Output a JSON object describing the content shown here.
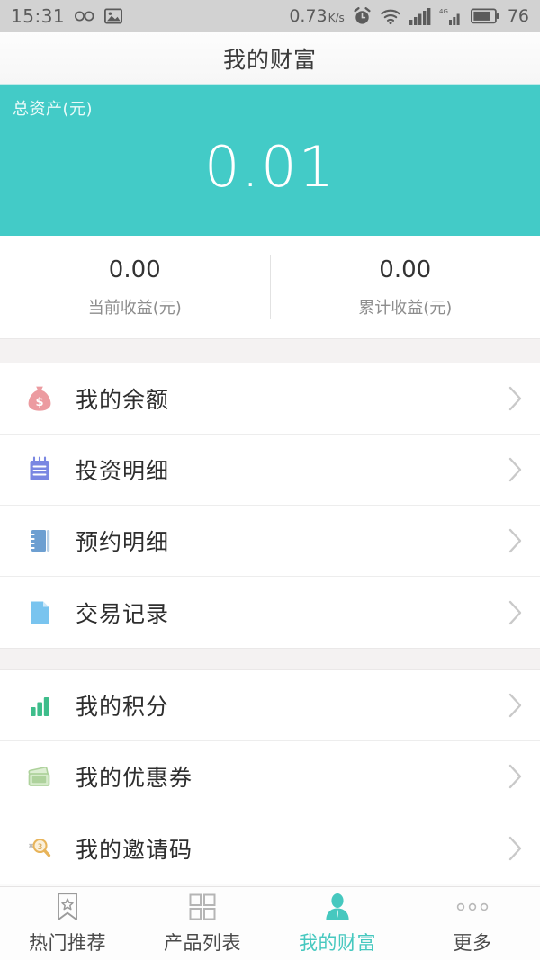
{
  "statusbar": {
    "time": "15:31",
    "infinity_icon": "infinity-icon",
    "gallery_icon": "image-icon",
    "network_speed": "0.73",
    "network_speed_unit": "K/s",
    "alarm_icon": "alarm-clock-icon",
    "wifi_icon": "wifi-icon",
    "signal_icon": "signal-bars-icon",
    "signal_4g_icon": "4g-signal-icon",
    "signal_4g_label": "4G",
    "battery_icon": "battery-icon",
    "battery_level": "76"
  },
  "titlebar": {
    "title": "我的财富"
  },
  "hero": {
    "label": "总资产(元)",
    "amount": "0.01",
    "background_color": "#43cbc7"
  },
  "stats": [
    {
      "value": "0.00",
      "caption": "当前收益(元)"
    },
    {
      "value": "0.00",
      "caption": "累计收益(元)"
    }
  ],
  "list_groups": [
    {
      "rows": [
        {
          "label": "我的余额",
          "icon": "money-bag-icon",
          "icon_color": "#ec9ba0"
        },
        {
          "label": "投资明细",
          "icon": "notepad-icon",
          "icon_color": "#7a87e2"
        },
        {
          "label": "预约明细",
          "icon": "notebook-icon",
          "icon_color": "#6d9fd1"
        },
        {
          "label": "交易记录",
          "icon": "document-icon",
          "icon_color": "#79c4ef"
        }
      ]
    },
    {
      "rows": [
        {
          "label": "我的积分",
          "icon": "bar-chart-icon",
          "icon_color": "#3ebd8b"
        },
        {
          "label": "我的优惠券",
          "icon": "coupon-icon",
          "icon_color": "#aed29c"
        },
        {
          "label": "我的邀请码",
          "icon": "magnifier-icon",
          "icon_color": "#e8b45a"
        }
      ]
    }
  ],
  "chevron_icon": "chevron-right-icon",
  "tabbar": {
    "items": [
      {
        "label": "热门推荐",
        "icon": "bookmark-star-icon",
        "active": false
      },
      {
        "label": "产品列表",
        "icon": "grid-icon",
        "active": false
      },
      {
        "label": "我的财富",
        "icon": "person-icon",
        "active": true
      },
      {
        "label": "更多",
        "icon": "more-dots-icon",
        "active": false
      }
    ],
    "active_color": "#46c8bf"
  }
}
